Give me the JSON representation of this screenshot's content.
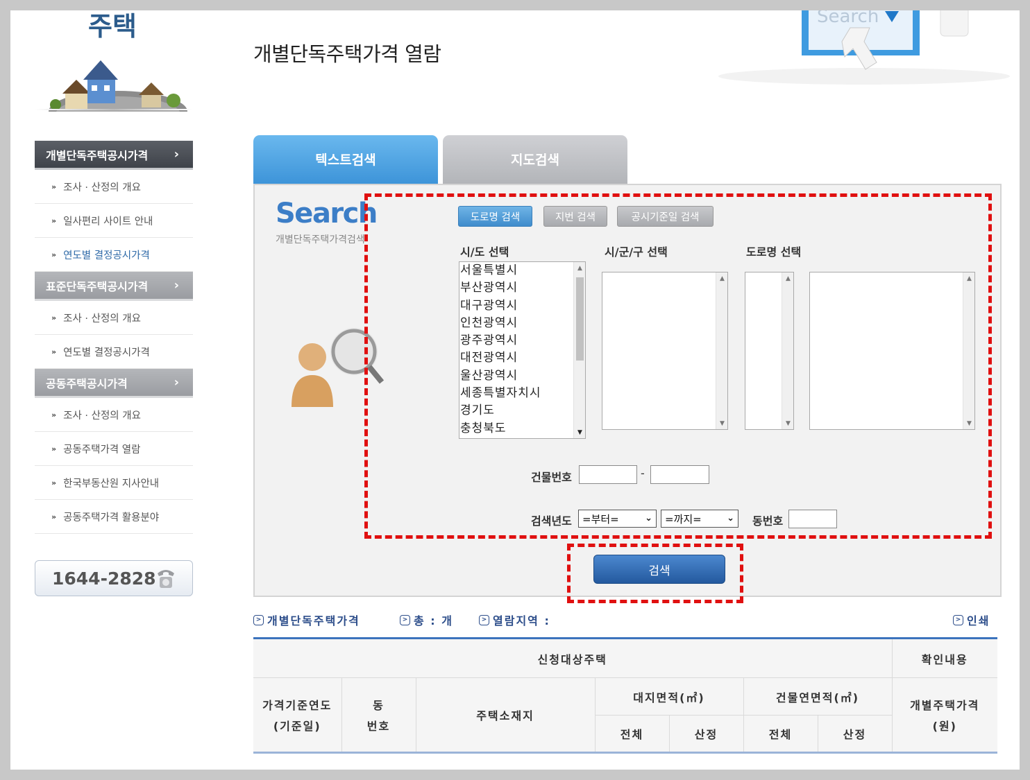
{
  "sidebar": {
    "brand": "주택",
    "sections": [
      {
        "title": "개별단독주택공시가격",
        "items": [
          "조사 · 산정의 개요",
          "일사편리 사이트 안내",
          "연도별 결정공시가격"
        ]
      },
      {
        "title": "표준단독주택공시가격",
        "items": [
          "조사 · 산정의 개요",
          "연도별 결정공시가격"
        ]
      },
      {
        "title": "공동주택공시가격",
        "items": [
          "조사 · 산정의 개요",
          "공동주택가격 열람",
          "한국부동산원 지사안내",
          "공동주택가격 활용분야"
        ]
      }
    ],
    "phone": "1644-2828"
  },
  "header": {
    "title": "개별단독주택가격 열람",
    "art_text": "Search"
  },
  "tabs": [
    "텍스트검색",
    "지도검색"
  ],
  "search": {
    "logo": "Search",
    "logo_sub": "개별단독주택가격검색",
    "sub_buttons": [
      "도로명 검색",
      "지번 검색",
      "공시기준일 검색"
    ],
    "labels": {
      "sido": "시/도 선택",
      "sigungu": "시/군/구 선택",
      "road": "도로명 선택"
    },
    "sido_options": [
      "서울특별시",
      "부산광역시",
      "대구광역시",
      "인천광역시",
      "광주광역시",
      "대전광역시",
      "울산광역시",
      "세종특별자치시",
      "경기도",
      "충청북도"
    ],
    "building_label": "건물번호",
    "dash": "-",
    "year_label": "검색년도",
    "year_from": "=부터=",
    "year_to": "=까지=",
    "dong_label": "동번호",
    "button": "검색"
  },
  "results": {
    "info": [
      "개별단독주택가격",
      "총 : 개",
      "열람지역 :"
    ],
    "print": "인쇄",
    "headers": {
      "group1": "신청대상주택",
      "group2": "확인내용",
      "year": [
        "가격기준연도",
        "(기준일)"
      ],
      "dong": [
        "동",
        "번호"
      ],
      "address": "주택소재지",
      "land_area": "대지면적(㎡)",
      "building_area": "건물연면적(㎡)",
      "price": [
        "개별주택가격",
        "(원)"
      ],
      "total": "전체",
      "calc": "산정"
    }
  },
  "colors": {
    "accent": "#3c93d8",
    "highlight": "#e01010",
    "menu_dark": "#3f434a"
  }
}
